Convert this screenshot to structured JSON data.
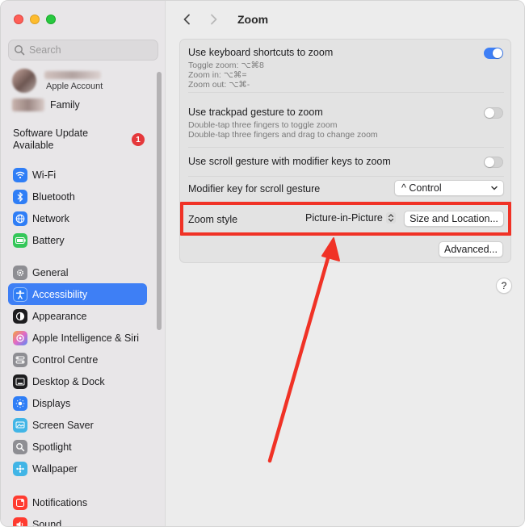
{
  "sidebar": {
    "search_placeholder": "Search",
    "account_label": "Apple Account",
    "family_label": "Family",
    "software_update": {
      "line1": "Software Update",
      "line2": "Available",
      "badge": "1"
    },
    "group1": [
      {
        "label": "Wi-Fi",
        "icon": "wifi-icon",
        "color": "#2f7ef6"
      },
      {
        "label": "Bluetooth",
        "icon": "bluetooth-icon",
        "color": "#2f7ef6"
      },
      {
        "label": "Network",
        "icon": "network-globe-icon",
        "color": "#2f7ef6"
      },
      {
        "label": "Battery",
        "icon": "battery-icon",
        "color": "#34c759"
      }
    ],
    "group2": [
      {
        "label": "General",
        "icon": "gear-icon",
        "color": "#8e8e93"
      },
      {
        "label": "Accessibility",
        "icon": "accessibility-icon",
        "color": "#2f7ef6",
        "active": true
      },
      {
        "label": "Appearance",
        "icon": "appearance-icon",
        "color": "#1d1d1f"
      },
      {
        "label": "Apple Intelligence & Siri",
        "icon": "siri-icon",
        "color": "#e06ac7"
      },
      {
        "label": "Control Centre",
        "icon": "control-centre-icon",
        "color": "#8e8e93"
      },
      {
        "label": "Desktop & Dock",
        "icon": "dock-icon",
        "color": "#1d1d1f"
      },
      {
        "label": "Displays",
        "icon": "displays-icon",
        "color": "#2f7ef6"
      },
      {
        "label": "Screen Saver",
        "icon": "screen-saver-icon",
        "color": "#41b5e6"
      },
      {
        "label": "Spotlight",
        "icon": "spotlight-icon",
        "color": "#8e8e93"
      },
      {
        "label": "Wallpaper",
        "icon": "wallpaper-icon",
        "color": "#41b5e6"
      }
    ],
    "group3": [
      {
        "label": "Notifications",
        "icon": "notifications-icon",
        "color": "#ff3b30"
      },
      {
        "label": "Sound",
        "icon": "sound-icon",
        "color": "#ff3b30"
      }
    ]
  },
  "header": {
    "title": "Zoom"
  },
  "zoom": {
    "keyboard": {
      "title": "Use keyboard shortcuts to zoom",
      "sub1": "Toggle zoom: ⌥⌘8",
      "sub2": "Zoom in: ⌥⌘=",
      "sub3": "Zoom out: ⌥⌘-",
      "enabled": true
    },
    "trackpad": {
      "title": "Use trackpad gesture to zoom",
      "sub1": "Double-tap three fingers to toggle zoom",
      "sub2": "Double-tap three fingers and drag to change zoom",
      "enabled": false
    },
    "scroll": {
      "title": "Use scroll gesture with modifier keys to zoom",
      "enabled": false
    },
    "modifier": {
      "title": "Modifier key for scroll gesture",
      "value": "^ Control"
    },
    "style": {
      "title": "Zoom style",
      "value": "Picture-in-Picture",
      "button": "Size and Location..."
    },
    "advanced_button": "Advanced...",
    "help": "?"
  },
  "colors": {
    "accent": "#3e7ff5",
    "highlight": "#f03226",
    "arrow": "#f03226"
  }
}
